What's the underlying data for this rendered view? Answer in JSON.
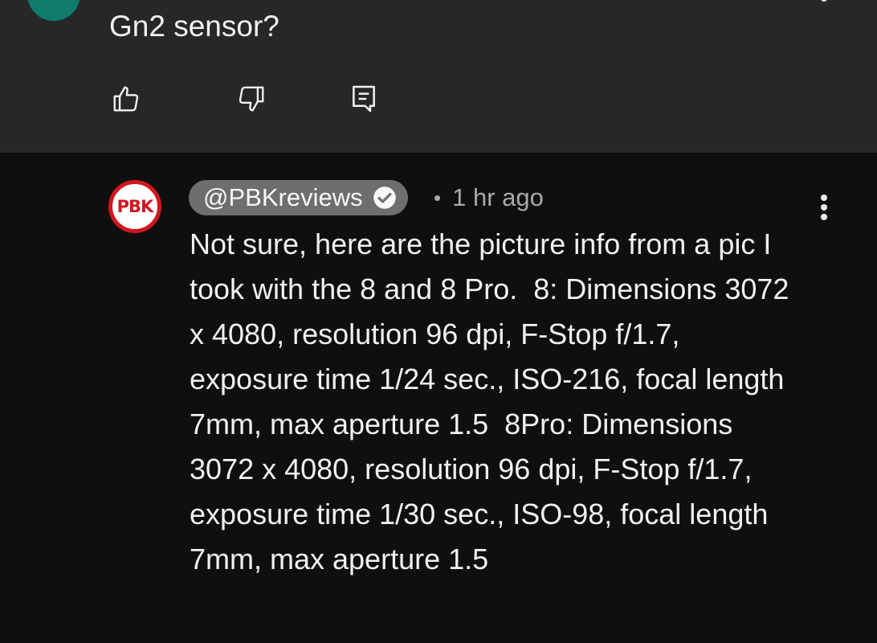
{
  "top_comment": {
    "text": "Gn2 sensor?"
  },
  "reply": {
    "avatar_text": "PBK",
    "author": "@PBKreviews",
    "separator": "•",
    "time": "1 hr ago",
    "body": "Not sure, here are the picture info from a pic I took with the 8 and 8 Pro.  8: Dimensions 3072 x 4080, resolution 96 dpi, F-Stop f/1.7, exposure time 1/24 sec., ISO-216, focal length 7mm, max aperture 1.5  8Pro: Dimensions 3072 x 4080, resolution 96 dpi, F-Stop f/1.7, exposure time 1/30 sec., ISO-98, focal length 7mm, max aperture 1.5"
  },
  "icons": {
    "like": "thumbs-up-icon",
    "dislike": "thumbs-down-icon",
    "reply": "reply-icon",
    "menu": "more-vert-icon",
    "verified": "verified-check-icon"
  },
  "colors": {
    "top_background": "#272727",
    "reply_background": "#0f0f0f",
    "author_chip": "#6e6e6e",
    "brand_red": "#d2161e",
    "top_avatar": "#0f7b6c"
  }
}
